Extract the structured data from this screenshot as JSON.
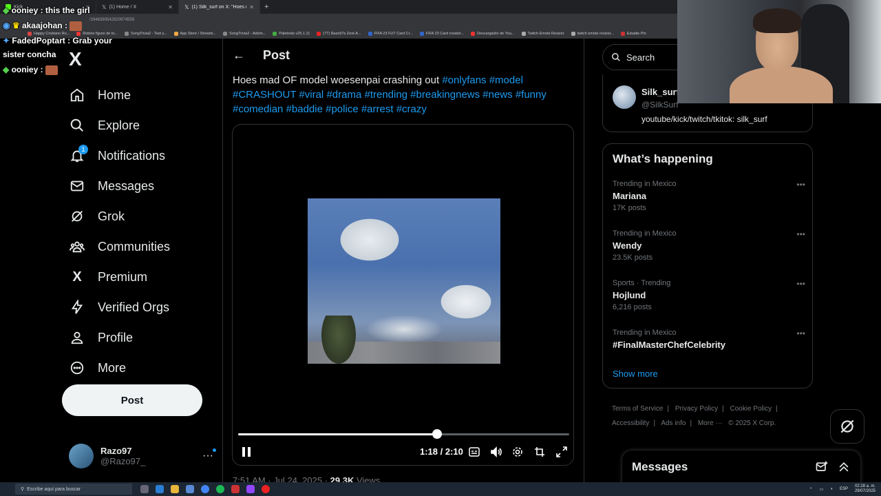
{
  "browser": {
    "tabs": [
      {
        "label": "Kick",
        "active": false
      },
      {
        "label": "(1) Home / X",
        "active": false
      },
      {
        "label": "(1) Silk_surf on X: \"Hoes m...",
        "active": true
      }
    ],
    "url_fragment": "/1948380542920974559",
    "bookmarks": [
      "Happy Cristiano Ro...",
      "Roblox figure de to...",
      "SongTrivia2 - Test y...",
      "App Store / Streami...",
      "SongTrivia2 - Adivin...",
      "Paletools v25.1.11",
      "(77) Razo97s Zest-A...",
      "FIFA 23 FUT Card Cr...",
      "FIFA 23 Card creator...",
      "Descargador de You...",
      "Twitch Emote Resizer",
      "twitch emote resizer...",
      "Estadio Pin"
    ]
  },
  "chat": [
    {
      "user": "ooniey",
      "text": ": this the girl"
    },
    {
      "user": "akaajohan",
      "text": ":"
    },
    {
      "user": "FadedPoptart",
      "text": ": Grab your"
    },
    {
      "user": "",
      "text": "sister concha"
    },
    {
      "user": "ooniey",
      "text": ":"
    }
  ],
  "nav": {
    "logo": "X",
    "items": [
      {
        "label": "Home",
        "icon": "home-icon"
      },
      {
        "label": "Explore",
        "icon": "search-icon"
      },
      {
        "label": "Notifications",
        "icon": "bell-icon",
        "badge": "1"
      },
      {
        "label": "Messages",
        "icon": "mail-icon"
      },
      {
        "label": "Grok",
        "icon": "grok-icon"
      },
      {
        "label": "Communities",
        "icon": "communities-icon"
      },
      {
        "label": "Premium",
        "icon": "x-logo-icon"
      },
      {
        "label": "Verified Orgs",
        "icon": "lightning-icon"
      },
      {
        "label": "Profile",
        "icon": "person-icon"
      },
      {
        "label": "More",
        "icon": "more-circle-icon"
      }
    ],
    "post_button": "Post",
    "account": {
      "name": "Razo97",
      "handle": "@Razo97_"
    }
  },
  "post": {
    "header": "Post",
    "text": "Hoes mad OF model woesenpai crashing out",
    "hashtags": [
      "#onlyfans",
      "#model",
      "#CRASHOUT",
      "#viral",
      "#drama",
      "#trending",
      "#breakingnews",
      "#news",
      "#funny",
      "#comedian",
      "#baddie",
      "#police",
      "#arrest",
      "#crazy"
    ],
    "video": {
      "time": "1:18 / 2:10",
      "progress": 0.6
    },
    "meta_partial": "7:51 AM · Jul 24, 2025 ·",
    "views_count": "29.3K",
    "views_label": "Views"
  },
  "right": {
    "search_placeholder": "Search",
    "profile": {
      "name": "Silk_surf",
      "handle": "@SilkSurf",
      "bio": "youtube/kick/twitch/tkitok: silk_surf"
    },
    "happening_title": "What’s happening",
    "trends": [
      {
        "context": "Trending in Mexico",
        "name": "Mariana",
        "count": "17K posts"
      },
      {
        "context": "Trending in Mexico",
        "name": "Wendy",
        "count": "23.5K posts"
      },
      {
        "context": "Sports · Trending",
        "name": "Hojlund",
        "count": "6,216 posts"
      },
      {
        "context": "Trending in Mexico",
        "name": "#FinalMasterChefCelebrity",
        "count": ""
      }
    ],
    "show_more": "Show more",
    "footer": [
      "Terms of Service",
      "|",
      "Privacy Policy",
      "|",
      "Cookie Policy",
      "|",
      "Accessibility",
      "|",
      "Ads info",
      "|",
      "More ···",
      "© 2025 X Corp."
    ],
    "messages_dock": "Messages"
  },
  "taskbar": {
    "search_placeholder": "Escribe aquí para buscar",
    "language": "ESP",
    "clock_time": "02:28 a. m.",
    "clock_date": "29/07/2025"
  },
  "colors": {
    "accent": "#1d9bf0",
    "background": "#000000",
    "text": "#e7e9ea",
    "muted": "#71767b"
  }
}
